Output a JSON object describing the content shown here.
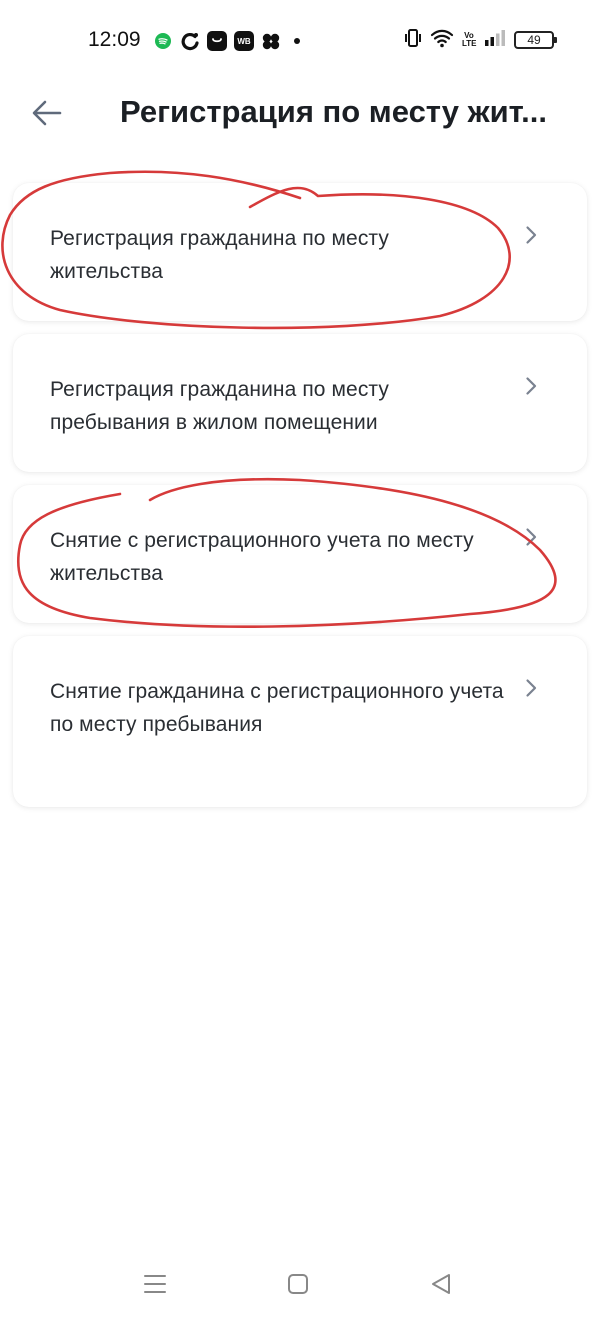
{
  "status_bar": {
    "time": "12:09",
    "battery_level": "49",
    "notification_icons": [
      "spotify-icon",
      "sync-app-icon",
      "shopping-bag-icon",
      "wb-app-icon",
      "clover-app-icon"
    ],
    "wb_label": "WB",
    "volte_label": "Vo\nLTE"
  },
  "header": {
    "title": "Регистрация по месту жит..."
  },
  "services": [
    {
      "label": "Регистрация гражданина по месту жительства",
      "annotated": true
    },
    {
      "label": "Регистрация гражданина по месту пребывания в жилом помещении",
      "annotated": false
    },
    {
      "label": "Снятие с регистрационного учета по месту жительства",
      "annotated": true
    },
    {
      "label": "Снятие гражданина с регистрационного учета по месту пребывания",
      "annotated": false
    }
  ],
  "colors": {
    "annotation": "#d63a3a",
    "chevron": "#7a8290",
    "back_arrow": "#5f6a7b"
  },
  "nav_bar": {
    "buttons": [
      "menu-icon",
      "home-icon",
      "back-triangle-icon"
    ]
  }
}
